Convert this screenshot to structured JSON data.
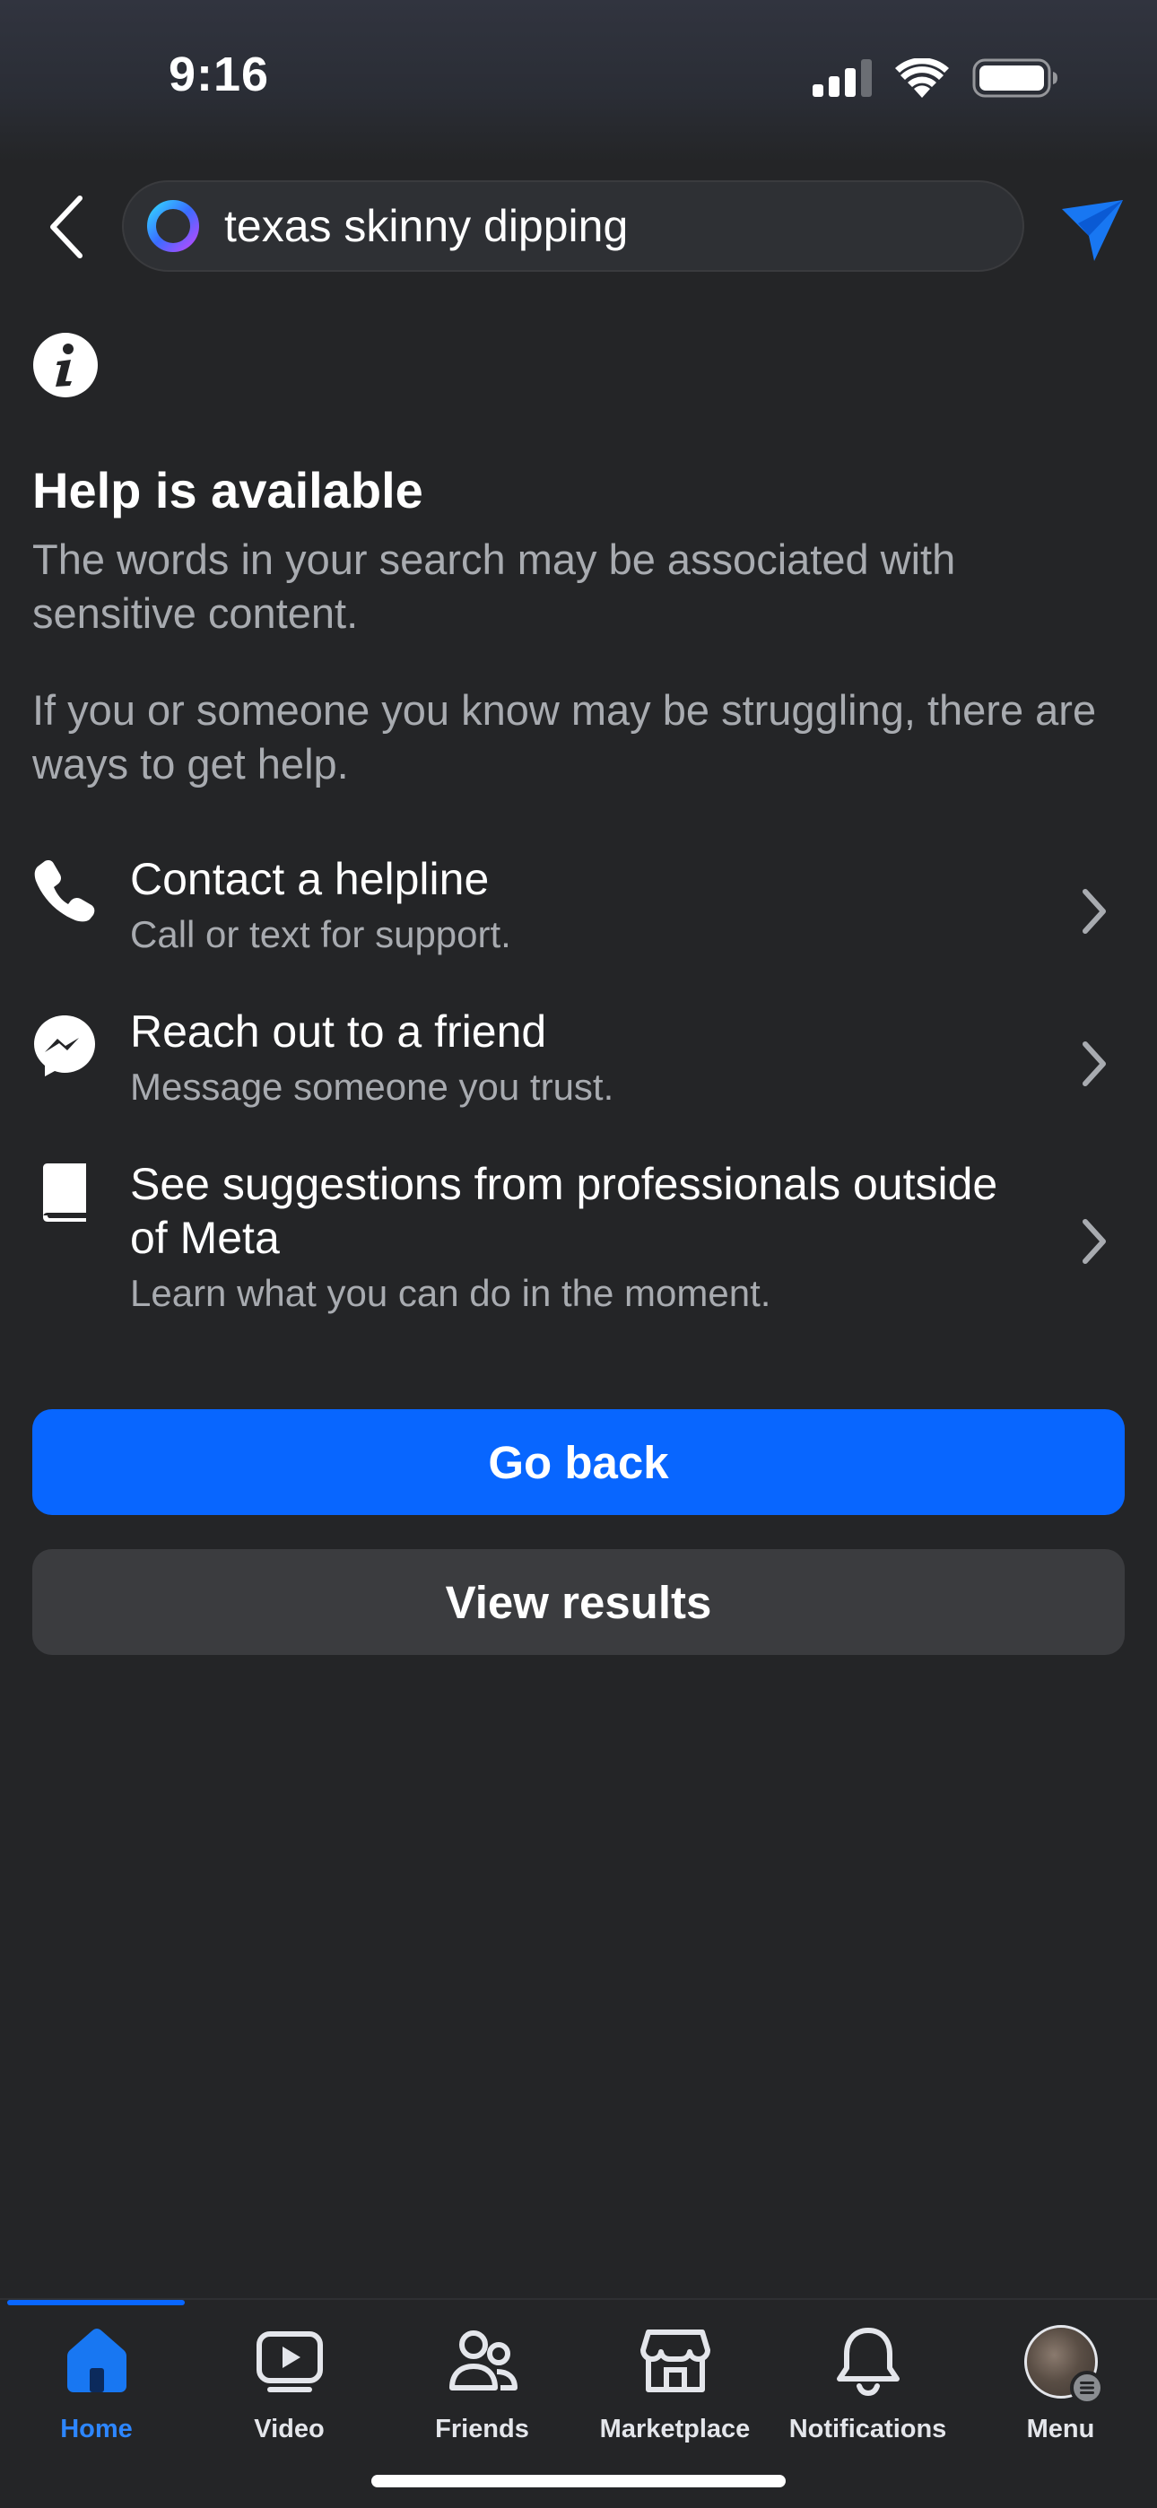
{
  "status_bar": {
    "time": "9:16",
    "icons": [
      "signal-icon",
      "wifi-icon",
      "battery-icon"
    ]
  },
  "search": {
    "query": "texas skinny dipping",
    "icon": "meta-ai-icon"
  },
  "help": {
    "title": "Help is available",
    "description": "The words in your search may be associated with sensitive content.",
    "description2": "If you or someone you know may be struggling, there are ways to get help."
  },
  "options": [
    {
      "title": "Contact a helpline",
      "subtitle": "Call or text for support.",
      "icon": "phone-icon"
    },
    {
      "title": "Reach out to a friend",
      "subtitle": "Message someone you trust.",
      "icon": "messenger-icon"
    },
    {
      "title": "See suggestions from professionals outside of Meta",
      "subtitle": "Learn what you can do in the moment.",
      "icon": "book-icon"
    }
  ],
  "buttons": {
    "go_back": "Go back",
    "view_results": "View results"
  },
  "tabs": [
    {
      "label": "Home",
      "icon": "home-icon",
      "active": true
    },
    {
      "label": "Video",
      "icon": "video-icon",
      "active": false
    },
    {
      "label": "Friends",
      "icon": "friends-icon",
      "active": false
    },
    {
      "label": "Marketplace",
      "icon": "marketplace-icon",
      "active": false
    },
    {
      "label": "Notifications",
      "icon": "bell-icon",
      "active": false
    },
    {
      "label": "Menu",
      "icon": "avatar",
      "active": false
    }
  ],
  "colors": {
    "background": "#242527",
    "accent": "#0866ff",
    "secondary_button": "#3b3c3f",
    "muted_text": "#a8abb0"
  }
}
